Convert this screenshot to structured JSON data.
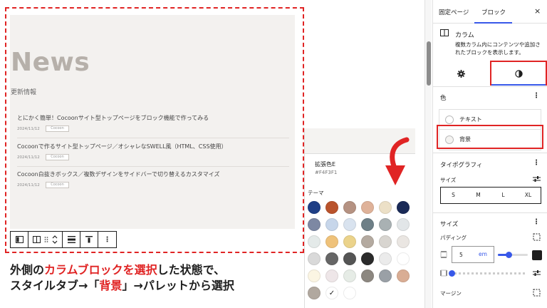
{
  "canvas": {
    "news": {
      "title": "News",
      "subtitle": "更新情報",
      "posts": [
        {
          "title": "とにかく簡単！Cocoonサイト型トップページをブロック機能で作ってみる",
          "date": "2024/11/12",
          "tag": "Cocoon"
        },
        {
          "title": "Cocoonで作るサイト型トップページ／オシャレなSWELL風（HTML、CSS使用）",
          "date": "2024/11/12",
          "tag": "Cocoon"
        },
        {
          "title": "Cocoon白抜きボックス／複数デザインをサイドバーで切り替えるカスタマイズ",
          "date": "2024/11/12",
          "tag": "Cocoon"
        }
      ]
    },
    "caption": {
      "line1_pre": "外側の",
      "line1_red": "カラムブロックを選択",
      "line1_post": "した状態で、",
      "line2_pre": "スタイルタブ→「",
      "line2_red": "背景",
      "line2_post": "」→パレットから選択"
    }
  },
  "popover": {
    "color_name": "拡張色E",
    "color_hex": "#F4F3F1",
    "theme_label": "テーマ",
    "swatches": [
      [
        "#1f3f86",
        "#b9532c",
        "#b59282",
        "#dfb299",
        "#ece0c7",
        "#1a2a57"
      ],
      [
        "#7d88a3",
        "#c7d6ea",
        "#d9e3ef",
        "#6e7f87",
        "#a9b1b3",
        "#e2e6e8"
      ],
      [
        "#e4eae9",
        "#efc27a",
        "#ebd38b",
        "#b4aaa0",
        "#d8d5d0",
        "#eae6e2"
      ],
      [
        "#d9d9d9",
        "#666666",
        "#555555",
        "#2b2b2b",
        "#ebebeb",
        "#ffffff"
      ],
      [
        "#fbf5e3",
        "#eee6e8",
        "#e6ece6",
        "#8c8780",
        "#9aa0a6",
        "#d9ad94"
      ],
      [
        "#b1a89f",
        "#ffffff",
        "#ffffff"
      ]
    ],
    "selected_swatch_mark": "✓"
  },
  "sidebar": {
    "tabs": {
      "page": "固定ページ",
      "block": "ブロック",
      "close": "×"
    },
    "block": {
      "name": "カラム",
      "description": "複数カラム内にコンテンツや追加されたブロックを表示します。"
    },
    "color_section": {
      "title": "色",
      "items": [
        {
          "label": "テキスト"
        },
        {
          "label": "背景"
        }
      ]
    },
    "typography": {
      "title": "タイポグラフィ",
      "size_label": "サイズ",
      "sizes": [
        "S",
        "M",
        "L",
        "XL"
      ]
    },
    "dimensions": {
      "title": "サイズ",
      "padding_label": "パディング",
      "padding_value": "5",
      "padding_unit": "em",
      "margin_label": "マージン"
    },
    "kebab": "⋮"
  }
}
